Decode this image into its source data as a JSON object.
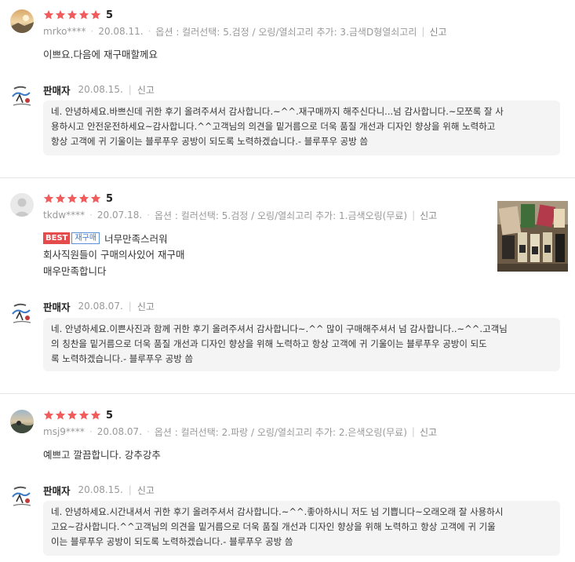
{
  "colors": {
    "star": "#f25b5b",
    "badge_best": "#e54b4b",
    "badge_rebuy": "#3b78cf"
  },
  "icons": {
    "rating": "star-icon",
    "seller_logo": "seller-logo-icon",
    "photo": "review-photo-thumbnail"
  },
  "reviews": [
    {
      "rating": "5",
      "stars_count": 5,
      "user": "mrko****",
      "date": "20.08.11.",
      "option": "옵션 : 컬러선택: 5.검정 / 오링/열쇠고리 추가: 3.금색D형열쇠고리",
      "report": "신고",
      "lines": [
        "이쁘요.다음에 재구매할께요"
      ],
      "seller": {
        "name": "판매자",
        "date": "20.08.15.",
        "report": "신고",
        "reply_lines": [
          "네. 안녕하세요.바쁘신데 귀한 후기 올려주셔서 감사합니다.~^^.재구매까지 해주신다니...넘 감사합니다.~모쪼록 잘 사",
          "용하시고 안전운전하세요~감사합니다.^^고객님의 의견을 밑거름으로 더욱 품질 개선과 디자인 향상을 위해 노력하고",
          "항상 고객에 귀 기울이는 블루푸우 공방이 되도록 노력하겠습니다.- 블루푸우 공방 씀"
        ]
      }
    },
    {
      "rating": "5",
      "stars_count": 5,
      "user": "tkdw****",
      "date": "20.07.18.",
      "option": "옵션 : 컬러선택: 5.검정 / 오링/열쇠고리 추가: 1.금색오링(무료)",
      "report": "신고",
      "badge_best": "BEST",
      "badge_rebuy": "재구매",
      "lines": [
        "너무만족스러워",
        "회사직원들이 구매의사있어 재구매",
        "매우만족합니다"
      ],
      "seller": {
        "name": "판매자",
        "date": "20.08.07.",
        "report": "신고",
        "reply_lines": [
          "네. 안녕하세요.이쁜사진과 함께 귀한 후기 올려주셔서 감사합니다~.^^ 많이 구매해주셔서 넘 감사합니다..~^^.고객님",
          "의 칭찬을 밑거름으로 더욱 품질 개선과 디자인 향상을 위해 노력하고 항상 고객에 귀 기울이는 블루푸우 공방이 되도",
          "록 노력하겠습니다.- 블루푸우 공방 씀"
        ]
      }
    },
    {
      "rating": "5",
      "stars_count": 5,
      "user": "msj9****",
      "date": "20.08.07.",
      "option": "옵션 : 컬러선택: 2.파랑 / 오링/열쇠고리 추가: 2.은색오링(무료)",
      "report": "신고",
      "lines": [
        "예쁘고 깔끔합니다. 강추강추"
      ],
      "seller": {
        "name": "판매자",
        "date": "20.08.15.",
        "report": "신고",
        "reply_lines": [
          "네. 안녕하세요.시간내셔서 귀한 후기 올려주셔서 감사합니다.~^^.좋아하시니 저도 넘 기쁩니다~오래오래 잘 사용하시",
          "고요~감사합니다.^^고객님의 의견을 밑거름으로 더욱 품질 개선과 디자인 향상을 위해 노력하고 항상 고객에 귀 기울",
          "이는 블루푸우 공방이 되도록 노력하겠습니다.- 블루푸우 공방 씀"
        ]
      }
    }
  ]
}
